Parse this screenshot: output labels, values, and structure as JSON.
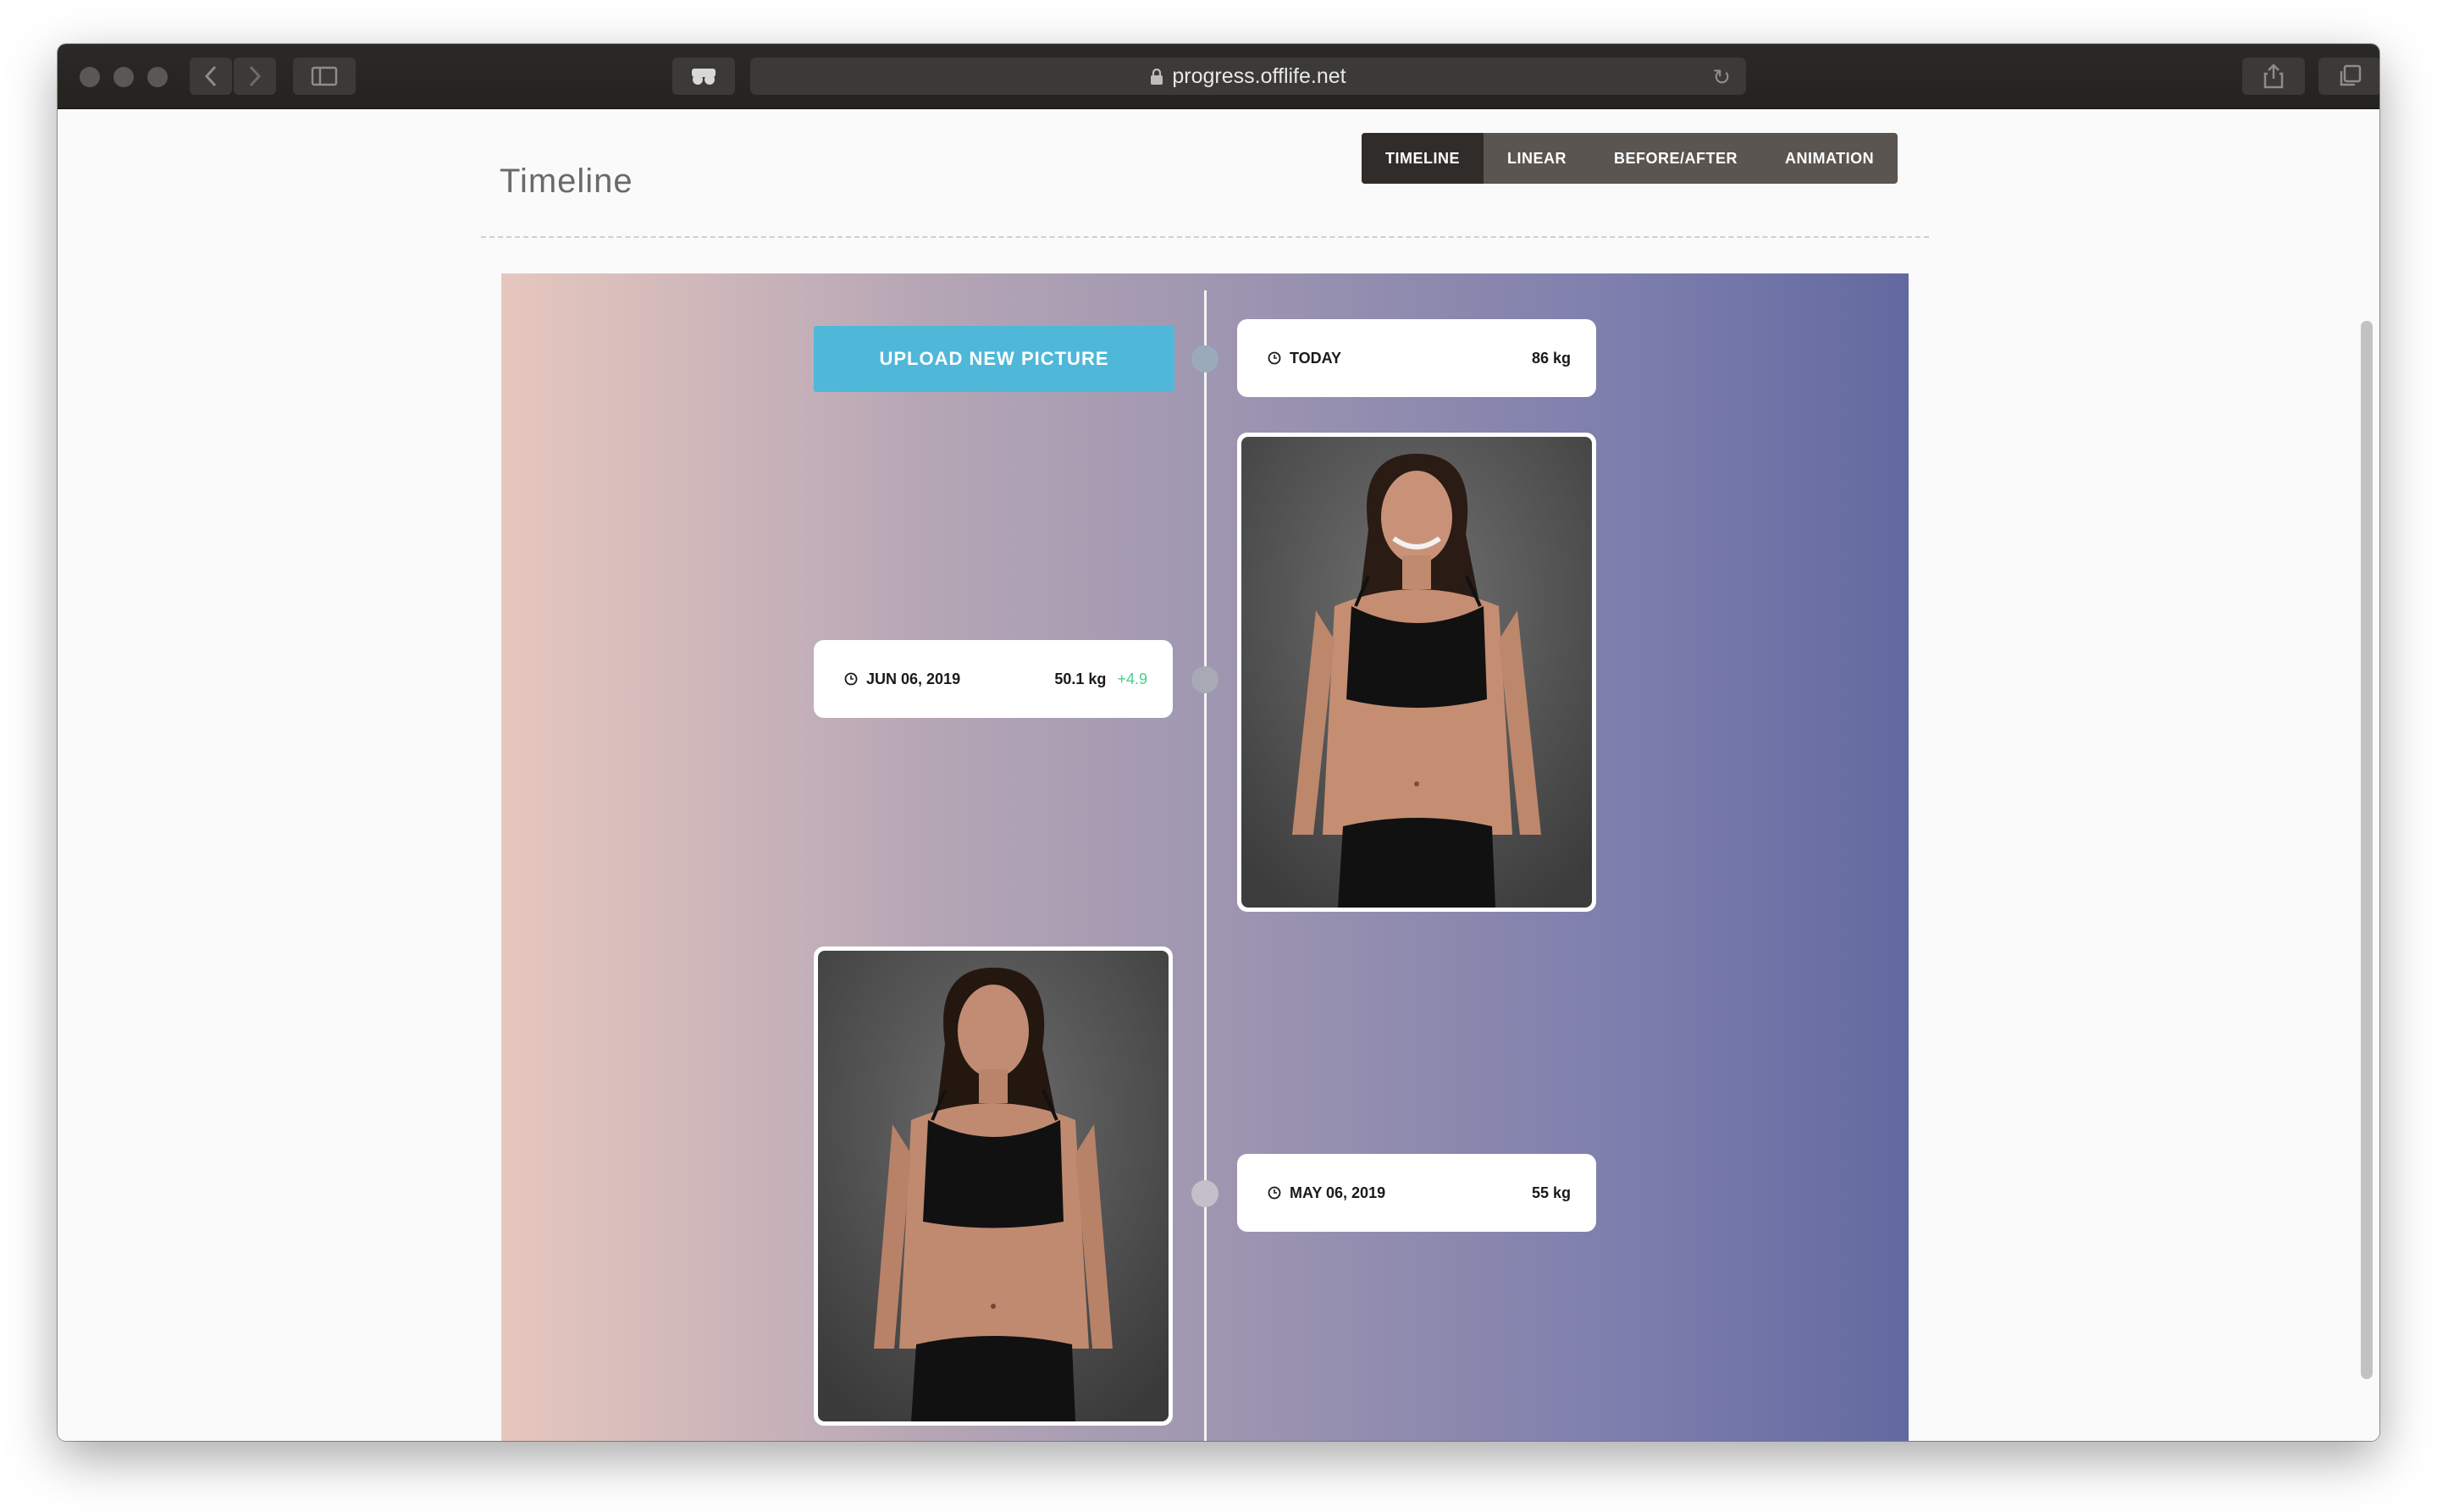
{
  "browser": {
    "url": "progress.offlife.net"
  },
  "page": {
    "title": "Timeline",
    "tabs": [
      {
        "label": "TIMELINE",
        "active": true
      },
      {
        "label": "LINEAR",
        "active": false
      },
      {
        "label": "BEFORE/AFTER",
        "active": false
      },
      {
        "label": "ANIMATION",
        "active": false
      }
    ]
  },
  "timeline": {
    "upload_label": "UPLOAD NEW PICTURE",
    "entries": [
      {
        "date": "TODAY",
        "weight": "86 kg",
        "delta": ""
      },
      {
        "date": "JUN 06, 2019",
        "weight": "50.1 kg",
        "delta": "+4.9"
      },
      {
        "date": "MAY 06, 2019",
        "weight": "55 kg",
        "delta": ""
      }
    ]
  },
  "colors": {
    "upload_button": "#4fb8d9",
    "active_tab": "#2f2c2a",
    "delta_positive": "#4bcf8a"
  }
}
